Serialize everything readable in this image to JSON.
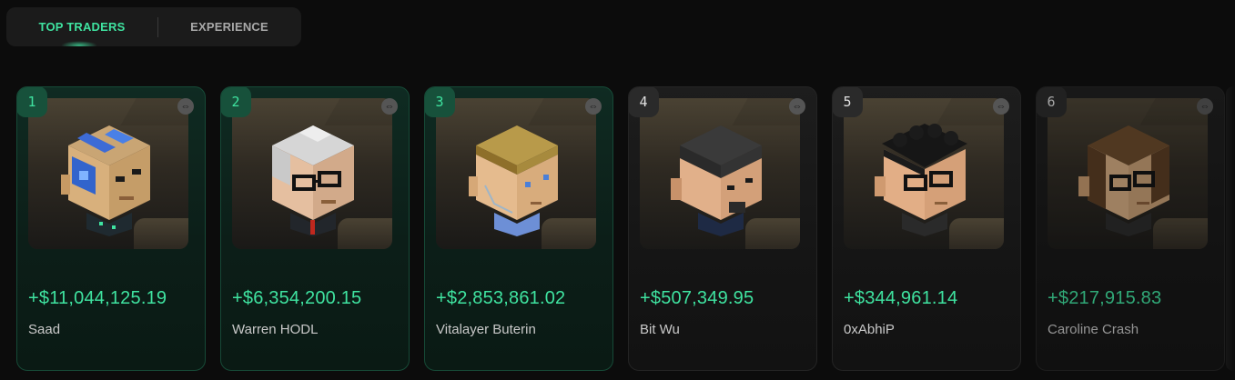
{
  "tabs": [
    {
      "label": "TOP TRADERS",
      "active": true
    },
    {
      "label": "EXPERIENCE",
      "active": false
    }
  ],
  "traders": [
    {
      "rank": "1",
      "value": "+$11,044,125.19",
      "name": "Saad",
      "style": "top"
    },
    {
      "rank": "2",
      "value": "+$6,354,200.15",
      "name": "Warren HODL",
      "style": "top"
    },
    {
      "rank": "3",
      "value": "+$2,853,861.02",
      "name": "Vitalayer Buterin",
      "style": "top"
    },
    {
      "rank": "4",
      "value": "+$507,349.95",
      "name": "Bit Wu",
      "style": "plain"
    },
    {
      "rank": "5",
      "value": "+$344,961.14",
      "name": "0xAbhiP",
      "style": "plain"
    },
    {
      "rank": "6",
      "value": "+$217,915.83",
      "name": "Caroline Crash",
      "style": "plain"
    }
  ],
  "icons": {
    "link": "link-icon",
    "avatar": "voxel-avatar"
  },
  "colors": {
    "accent": "#3fe3a0",
    "background": "#0c0c0c",
    "top_card": "#0f2b22",
    "plain_card": "#1d1d1d"
  }
}
